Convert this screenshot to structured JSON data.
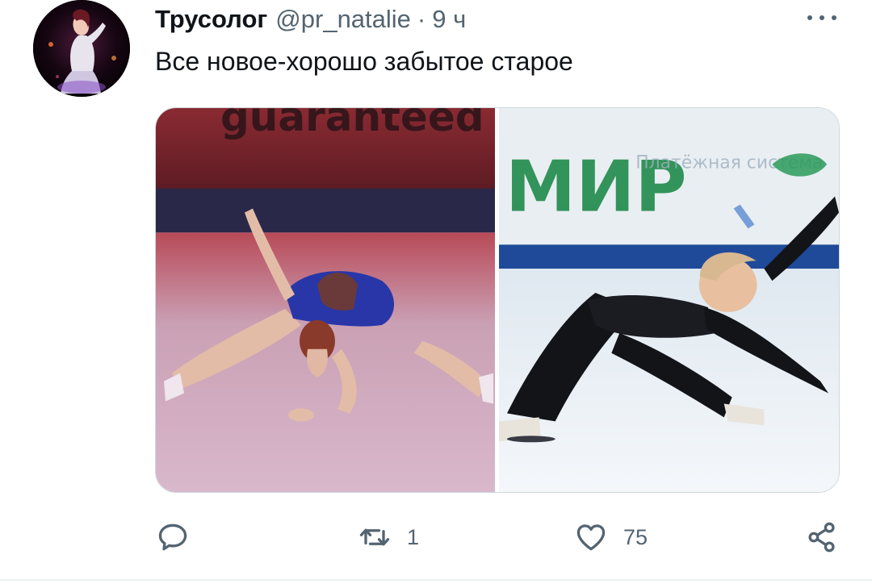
{
  "tweet": {
    "display_name": "Трусолог",
    "handle": "@pr_natalie",
    "separator": "·",
    "time": "9 ч",
    "text": "Все новое-хорошо забытое старое",
    "more_icon": "more-horizontal-icon"
  },
  "media": {
    "left_banner_text": "guaranteed",
    "right_banner_text": "МИР",
    "right_banner_subtext": "Платёжная система"
  },
  "actions": {
    "reply": {
      "icon": "reply-icon",
      "count": ""
    },
    "retweet": {
      "icon": "retweet-icon",
      "count": "1"
    },
    "like": {
      "icon": "heart-icon",
      "count": "75"
    },
    "share": {
      "icon": "share-icon",
      "count": ""
    }
  },
  "colors": {
    "text_primary": "#0f1419",
    "text_secondary": "#536471",
    "border": "#cfd9de"
  }
}
